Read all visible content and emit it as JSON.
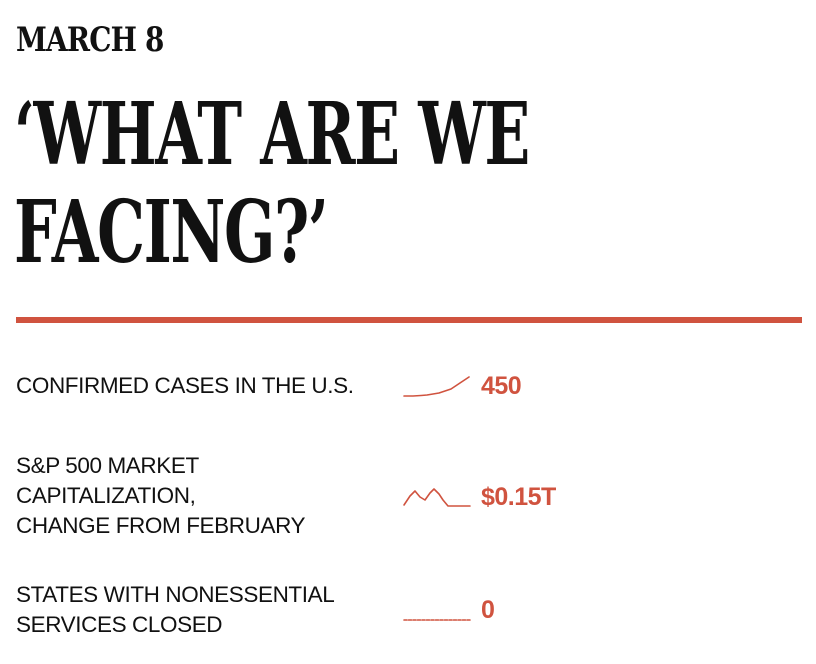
{
  "header": {
    "date": "MARCH 8",
    "headline_lines": [
      "‘WHAT ARE WE",
      "FACING?’"
    ]
  },
  "accent_color": "#d0533f",
  "stats": [
    {
      "label_lines": [
        "CONFIRMED CASES IN THE U.S."
      ],
      "value": "450",
      "sparkline_icon": "rising-curve-sparkline"
    },
    {
      "label_lines": [
        "S&P 500 MARKET",
        "CAPITALIZATION,",
        "CHANGE FROM FEBRUARY"
      ],
      "value": "$0.15T",
      "sparkline_icon": "zigzag-then-flat-sparkline"
    },
    {
      "label_lines": [
        "STATES WITH NONESSENTIAL",
        "SERVICES CLOSED"
      ],
      "value": "0",
      "sparkline_icon": "flat-sparkline"
    }
  ]
}
